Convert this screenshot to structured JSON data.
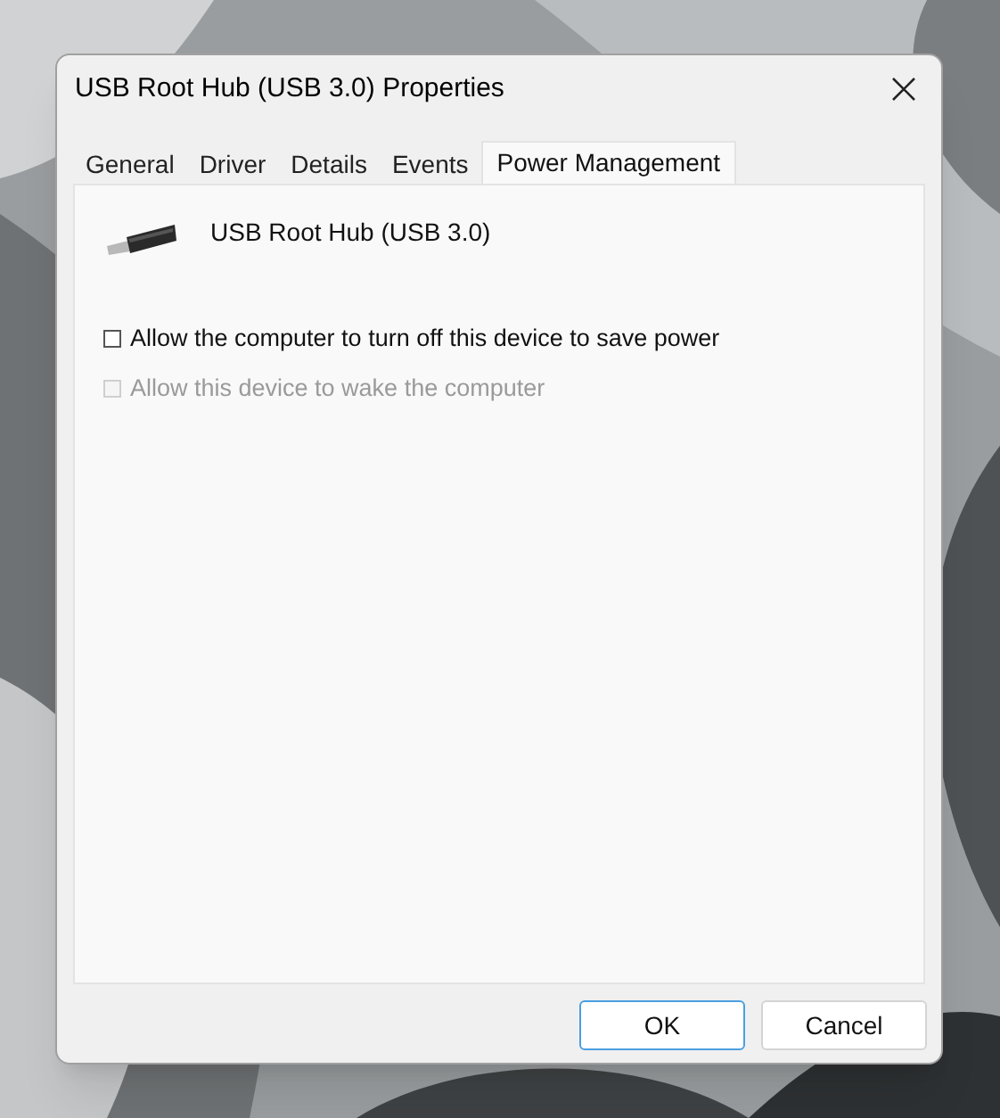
{
  "window": {
    "title": "USB Root Hub (USB 3.0) Properties"
  },
  "tabs": [
    {
      "label": "General",
      "selected": false
    },
    {
      "label": "Driver",
      "selected": false
    },
    {
      "label": "Details",
      "selected": false
    },
    {
      "label": "Events",
      "selected": false
    },
    {
      "label": "Power Management",
      "selected": true
    }
  ],
  "device": {
    "name": "USB Root Hub (USB 3.0)"
  },
  "options": [
    {
      "label": "Allow the computer to turn off this device to save power",
      "checked": false,
      "disabled": false
    },
    {
      "label": "Allow this device to wake the computer",
      "checked": false,
      "disabled": true
    }
  ],
  "buttons": [
    {
      "label": "OK",
      "kind": "default"
    },
    {
      "label": "Cancel",
      "kind": "normal"
    }
  ]
}
